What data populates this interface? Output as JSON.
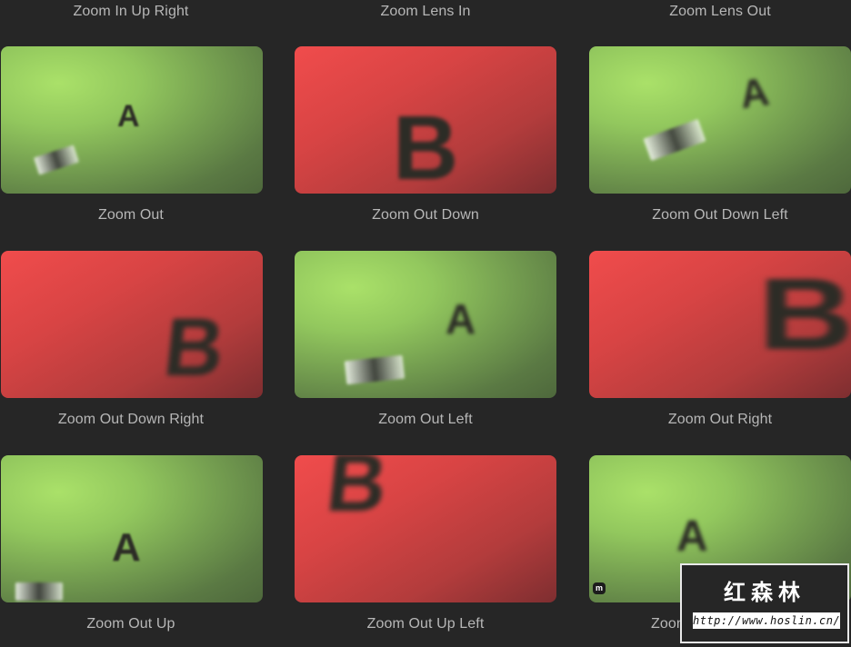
{
  "grid": {
    "top_labels": [
      "Zoom In Up Right",
      "Zoom Lens In",
      "Zoom Lens Out"
    ],
    "items": [
      {
        "label": "Zoom Out",
        "letter": "A",
        "bg": "green"
      },
      {
        "label": "Zoom Out Down",
        "letter": "B",
        "bg": "red"
      },
      {
        "label": "Zoom Out Down Left",
        "letter": "A",
        "bg": "green"
      },
      {
        "label": "Zoom Out Down Right",
        "letter": "B",
        "bg": "red"
      },
      {
        "label": "Zoom Out Left",
        "letter": "A",
        "bg": "green"
      },
      {
        "label": "Zoom Out Right",
        "letter": "B",
        "bg": "red"
      },
      {
        "label": "Zoom Out Up",
        "letter": "A",
        "bg": "green"
      },
      {
        "label": "Zoom Out Up Left",
        "letter": "B",
        "bg": "red"
      },
      {
        "label": "Zoom Out Up Right",
        "letter": "A",
        "bg": "green"
      }
    ]
  },
  "last_label_visible": "Zoom",
  "thumb_mark": "m",
  "colors": {
    "background": "#262626",
    "green_accent": "#a6e06a",
    "red_accent": "#f04c4c",
    "label": "#b7b7b7"
  },
  "watermark": {
    "title": "红森林",
    "url": "http://www.hoslin.cn/"
  }
}
